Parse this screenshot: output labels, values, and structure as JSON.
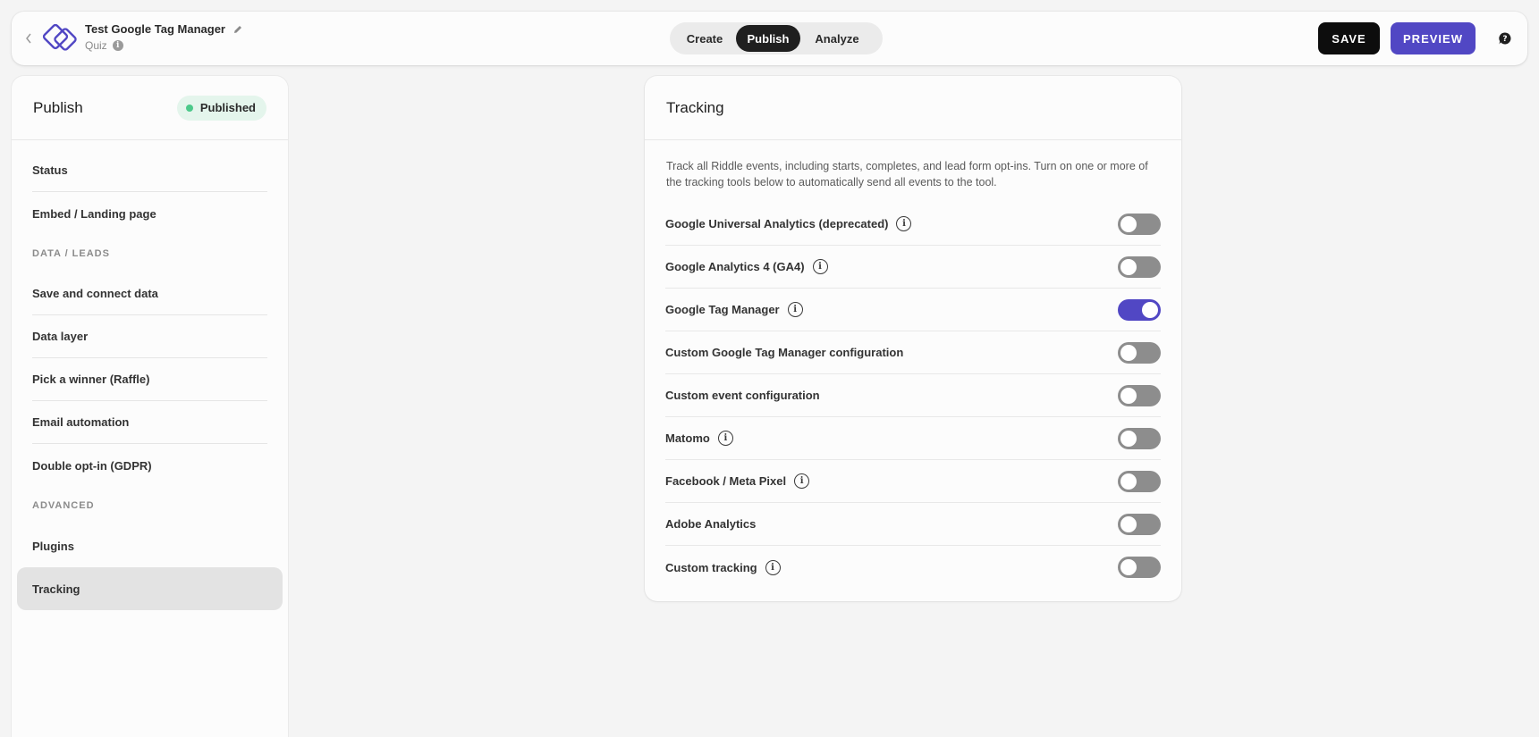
{
  "header": {
    "project_title": "Test Google Tag Manager",
    "project_type": "Quiz",
    "tabs": [
      {
        "label": "Create",
        "active": false
      },
      {
        "label": "Publish",
        "active": true
      },
      {
        "label": "Analyze",
        "active": false
      }
    ],
    "save_label": "SAVE",
    "preview_label": "PREVIEW",
    "icons": [
      "back-chevron-icon",
      "logo-icon",
      "pencil-icon",
      "info-icon",
      "help-chat-icon"
    ]
  },
  "sidebar": {
    "title": "Publish",
    "status": "Published",
    "status_color": "#4cc98a",
    "items": [
      {
        "label": "Status"
      },
      {
        "label": "Embed / Landing page"
      }
    ],
    "section_data_leads": "DATA / LEADS",
    "data_items": [
      {
        "label": "Save and connect data"
      },
      {
        "label": "Data layer"
      },
      {
        "label": "Pick a winner (Raffle)"
      },
      {
        "label": "Email automation"
      },
      {
        "label": "Double opt-in (GDPR)"
      }
    ],
    "section_advanced": "ADVANCED",
    "advanced_items": [
      {
        "label": "Plugins"
      },
      {
        "label": "Tracking",
        "active": true
      }
    ]
  },
  "tracking": {
    "title": "Tracking",
    "description": "Track all Riddle events, including starts, completes, and lead form opt-ins. Turn on one or more of the tracking tools below to automatically send all events to the tool.",
    "rows": [
      {
        "label": "Google Universal Analytics (deprecated)",
        "info": true,
        "enabled": false
      },
      {
        "label": "Google Analytics 4 (GA4)",
        "info": true,
        "enabled": false
      },
      {
        "label": "Google Tag Manager",
        "info": true,
        "enabled": true
      },
      {
        "label": "Custom Google Tag Manager configuration",
        "info": false,
        "enabled": false
      },
      {
        "label": "Custom event configuration",
        "info": false,
        "enabled": false
      },
      {
        "label": "Matomo",
        "info": true,
        "enabled": false
      },
      {
        "label": "Facebook / Meta Pixel",
        "info": true,
        "enabled": false
      },
      {
        "label": "Adobe Analytics",
        "info": false,
        "enabled": false
      },
      {
        "label": "Custom tracking",
        "info": true,
        "enabled": false
      }
    ]
  },
  "colors": {
    "accent": "#5147c4",
    "toggle_off": "#8d8d8d",
    "background": "#f4f4f4"
  }
}
